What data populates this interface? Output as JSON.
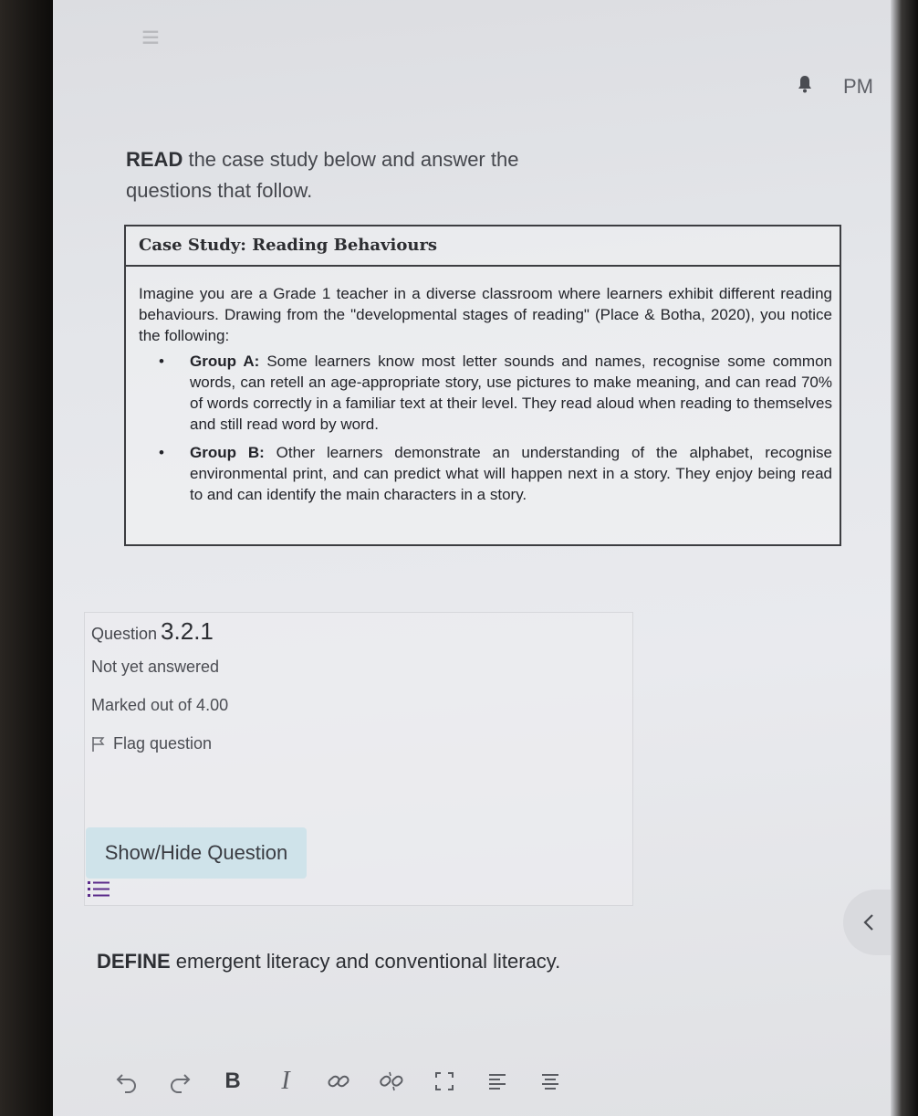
{
  "header": {
    "user_initials": "PM"
  },
  "intro": {
    "verb": "READ",
    "rest": " the case study below and answer the questions that follow."
  },
  "case_study": {
    "title": "Case Study: Reading Behaviours",
    "intro": "Imagine you are a Grade 1 teacher in a diverse classroom where learners exhibit different reading behaviours. Drawing from the \"developmental stages of reading\" (Place & Botha, 2020), you notice the following:",
    "groups": [
      {
        "label": "Group A:",
        "text": " Some learners know most letter sounds and names, recognise some common words, can retell an age-appropriate story, use pictures to make meaning, and can read 70% of words correctly in a familiar text at their level. They read aloud when reading to themselves and still read word by word."
      },
      {
        "label": "Group B:",
        "text": " Other learners demonstrate an understanding of the alphabet, recognise environmental print, and can predict what will happen next in a story. They enjoy being read to and can identify the main characters in a story."
      }
    ]
  },
  "question": {
    "label_word": "Question",
    "number": "3.2.1",
    "status": "Not yet answered",
    "marks": "Marked out of 4.00",
    "flag_label": "Flag question",
    "toggle_label": "Show/Hide Question"
  },
  "prompt": {
    "verb": "DEFINE",
    "rest": " emergent literacy and conventional literacy."
  },
  "toolbar": {
    "bold_label": "B",
    "italic_label": "I"
  }
}
